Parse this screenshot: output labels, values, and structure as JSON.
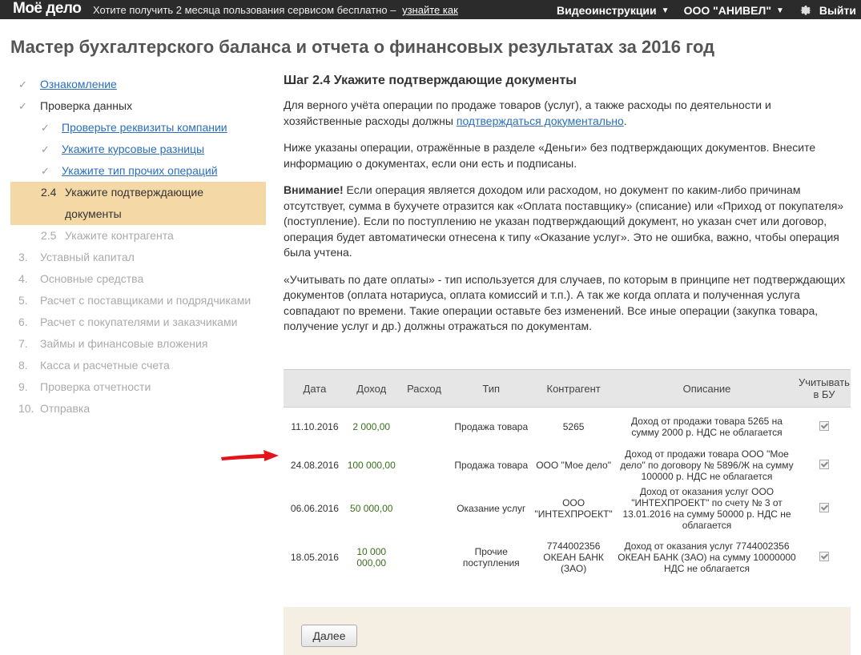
{
  "topbar": {
    "logo": "Моё дело",
    "promo_text": "Хотите получить 2 месяца пользования сервисом бесплатно –",
    "promo_link": "узнайте как",
    "video": "Видеоинструкции",
    "company": "ООО \"АНИВЕЛ\"",
    "exit": "Выйти"
  },
  "page_title": "Мастер бухгалтерского баланса и отчета о финансовых результатах за 2016 год",
  "sidebar": {
    "items": [
      {
        "label": "Ознакомление"
      },
      {
        "label": "Проверка данных"
      },
      {
        "label": "Проверьте реквизиты компании"
      },
      {
        "label": "Укажите курсовые разницы"
      },
      {
        "label": "Укажите тип прочих операций"
      },
      {
        "num": "2.4",
        "label": "Укажите подтверждающие документы"
      },
      {
        "num": "2.5",
        "label": "Укажите контрагента"
      },
      {
        "num": "3.",
        "label": "Уставный капитал"
      },
      {
        "num": "4.",
        "label": "Основные средства"
      },
      {
        "num": "5.",
        "label": "Расчет с поставщиками и подрядчиками"
      },
      {
        "num": "6.",
        "label": "Расчет с покупателями и заказчиками"
      },
      {
        "num": "7.",
        "label": "Займы и финансовые вложения"
      },
      {
        "num": "8.",
        "label": "Касса и расчетные счета"
      },
      {
        "num": "9.",
        "label": "Проверка отчетности"
      },
      {
        "num": "10.",
        "label": "Отправка"
      }
    ]
  },
  "main": {
    "step_title": "Шаг 2.4 Укажите подтверждающие документы",
    "p1_text": "Для верного учёта операции по продаже товаров (услуг), а также расходы по деятельности и хозяйственные расходы должны",
    "p1_link": "подтверждаться документально",
    "p1_end": ".",
    "p2": "Ниже указаны операции, отражённые в разделе «Деньги» без подтверждающих документов. Внесите информацию о документах, если они есть и подписаны.",
    "p3_bold": "Внимание!",
    "p3_text": " Если операция является доходом или расходом, но документ по каким-либо причинам отсутствует, сумма в бухучете отразится как «Оплата поставщику» (списание) или «Приход от покупателя» (поступление). Если по поступлению не указан подтверждающий документ, но указан счет или договор, операция будет автоматически отнесена к типу «Оказание услуг». Это не ошибка, важно, чтобы операция была учтена.",
    "p4": "«Учитывать по дате оплаты» - тип используется для случаев, по которым в принципе нет подтверждающих документов (оплата нотариуса, оплата комиссий и т.п.). А так же когда оплата и полученная услуга совпадают по времени. Такие операции оставьте без изменений. Все иные операции (закупка товара, получение услуг и др.) должны отражаться по документам."
  },
  "table": {
    "headers": [
      "Дата",
      "Доход",
      "Расход",
      "Тип",
      "Контрагент",
      "Описание",
      "Учитывать в БУ"
    ],
    "rows": [
      {
        "date": "11.10.2016",
        "income": "2 000,00",
        "expense": "",
        "type": "Продажа товара",
        "contractor": "5265",
        "desc": "Доход от продажи товара 5265 на сумму 2000 р. НДС не облагается"
      },
      {
        "date": "24.08.2016",
        "income": "100 000,00",
        "expense": "",
        "type": "Продажа товара",
        "contractor": "ООО \"Мое дело\"",
        "desc": "Доход от продажи товара ООО \"Мое дело\" по договору № 5896/Ж на сумму 100000 р. НДС не облагается"
      },
      {
        "date": "06.06.2016",
        "income": "50 000,00",
        "expense": "",
        "type": "Оказание услуг",
        "contractor": "ООО \"ИНТЕХПРОЕКТ\"",
        "desc": "Доход от оказания услуг ООО \"ИНТЕХПРОЕКТ\" по счету № 3 от 13.01.2016 на сумму 50000 р. НДС не облагается"
      },
      {
        "date": "18.05.2016",
        "income": "10 000 000,00",
        "expense": "",
        "type": "Прочие поступления",
        "contractor": "7744002356 ОКЕАН БАНК (ЗАО)",
        "desc": "Доход от оказания услуг 7744002356 ОКЕАН БАНК (ЗАО) на сумму 10000000 НДС не облагается"
      }
    ]
  },
  "footer": {
    "next_label": "Далее"
  },
  "colors": {
    "topbar": "#2b2b2b",
    "active_step": "#f4d8a6",
    "link": "#2a6ebb",
    "money": "#3a6e1a",
    "arrow": "#e5121a"
  }
}
